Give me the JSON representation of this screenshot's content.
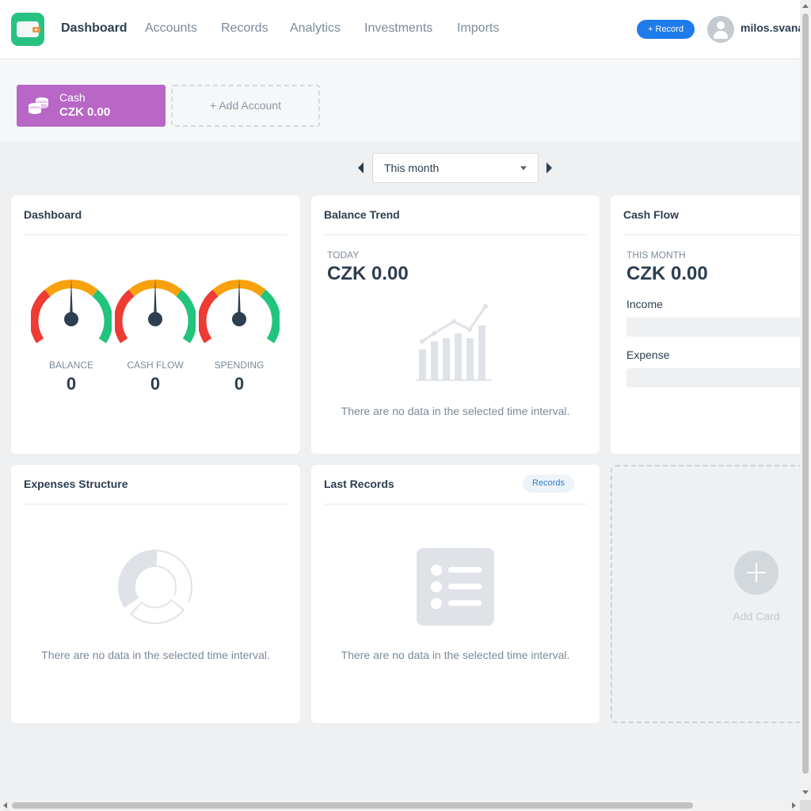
{
  "header": {
    "nav": [
      {
        "label": "Dashboard",
        "active": true
      },
      {
        "label": "Accounts"
      },
      {
        "label": "Records"
      },
      {
        "label": "Analytics"
      },
      {
        "label": "Investments"
      },
      {
        "label": "Imports"
      }
    ],
    "record_button": "+ Record",
    "username": "milos.svana"
  },
  "accounts": {
    "items": [
      {
        "name": "Cash",
        "balance": "CZK 0.00",
        "color": "#b867c6"
      }
    ],
    "add_label": "+ Add Account"
  },
  "period": {
    "selected": "This month"
  },
  "cards": {
    "dashboard": {
      "title": "Dashboard",
      "gauges": [
        {
          "label": "BALANCE",
          "value": "0"
        },
        {
          "label": "CASH FLOW",
          "value": "0"
        },
        {
          "label": "SPENDING",
          "value": "0"
        }
      ]
    },
    "balance_trend": {
      "title": "Balance Trend",
      "period_label": "TODAY",
      "value": "CZK 0.00",
      "empty": "There are no data in the selected time interval."
    },
    "cash_flow": {
      "title": "Cash Flow",
      "period_label": "THIS MONTH",
      "value": "CZK 0.00",
      "income_label": "Income",
      "expense_label": "Expense"
    },
    "expenses_structure": {
      "title": "Expenses Structure",
      "empty": "There are no data in the selected time interval."
    },
    "last_records": {
      "title": "Last Records",
      "chip": "Records",
      "empty": "There are no data in the selected time interval."
    },
    "add_card": {
      "label": "Add Card"
    }
  },
  "colors": {
    "brand": "#27c281",
    "accent": "#1e7bea",
    "gauge_red": "#ee3b33",
    "gauge_orange": "#f8a10d",
    "gauge_green": "#21c47c"
  }
}
